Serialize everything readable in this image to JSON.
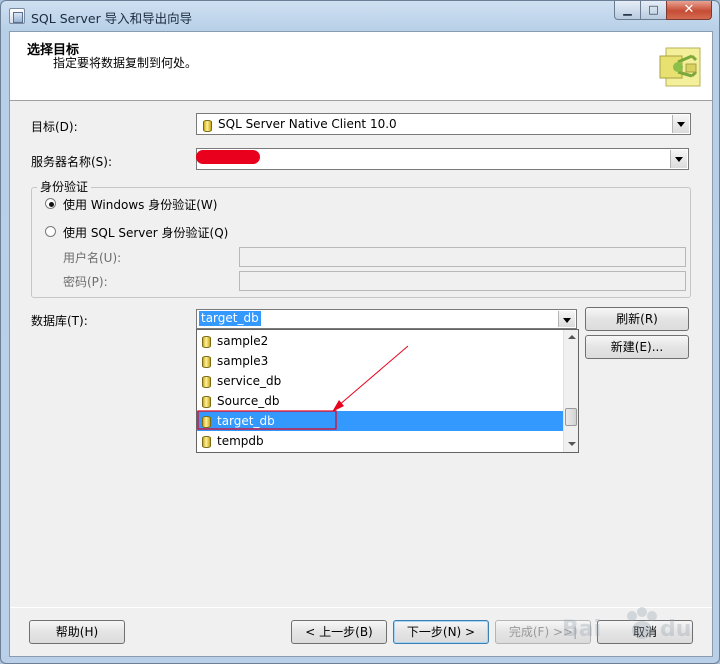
{
  "window": {
    "title": "SQL Server 导入和导出向导",
    "minimize_icon": "minimize-icon",
    "maximize_icon": "maximize-icon",
    "close_icon": "close-icon"
  },
  "header": {
    "title": "选择目标",
    "subtitle": "指定要将数据复制到何处。"
  },
  "form": {
    "destination_label": "目标(D):",
    "destination_value": "SQL Server Native Client 10.0",
    "server_label": "服务器名称(S):",
    "server_value": "",
    "auth_group_label": "身份验证",
    "auth_windows_label": "使用 Windows 身份验证(W)",
    "auth_sql_label": "使用 SQL Server 身份验证(Q)",
    "auth_selected": "windows",
    "username_label": "用户名(U):",
    "password_label": "密码(P):",
    "database_label": "数据库(T):",
    "database_value": "target_db",
    "refresh_button": "刷新(R)",
    "new_button": "新建(E)..."
  },
  "database_list": {
    "items": [
      "sample2",
      "sample3",
      "service_db",
      "Source_db",
      "target_db",
      "tempdb"
    ],
    "selected": "target_db"
  },
  "footer": {
    "help_button": "帮助(H)",
    "back_button": "< 上一步(B)",
    "next_button": "下一步(N) >",
    "finish_button": "完成(F) >>|",
    "cancel_button": "取消"
  },
  "colors": {
    "selection": "#3399ff",
    "annotation": "#e8001c",
    "window_frame": "#b9d0e8"
  }
}
